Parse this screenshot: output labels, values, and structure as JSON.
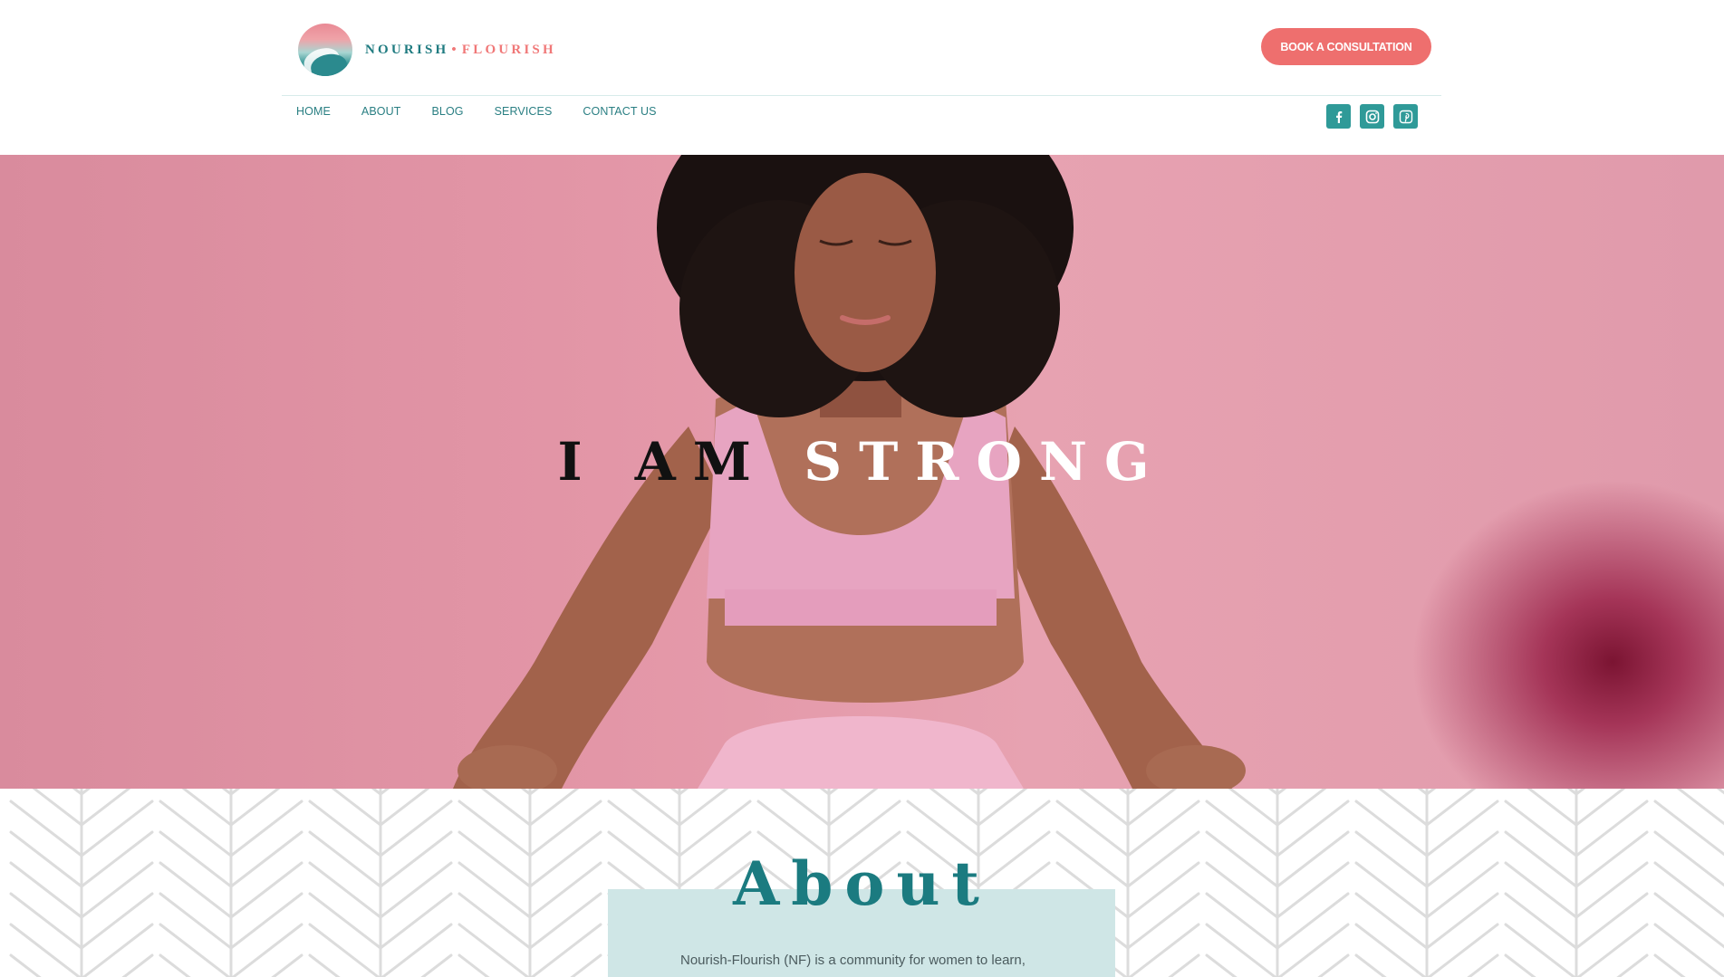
{
  "brand": {
    "name_part1": "NOURISH",
    "separator": "•",
    "name_part2": "FLOURISH",
    "colors": {
      "teal": "#1f7b80",
      "coral": "#ee6f6e",
      "social_bg": "#2f9a98"
    }
  },
  "header": {
    "cta_label": "BOOK A CONSULTATION"
  },
  "nav": {
    "items": [
      {
        "label": "HOME"
      },
      {
        "label": "ABOUT"
      },
      {
        "label": "BLOG"
      },
      {
        "label": "SERVICES"
      },
      {
        "label": "CONTACT US"
      }
    ]
  },
  "social": [
    {
      "icon": "facebook-icon"
    },
    {
      "icon": "instagram-icon"
    },
    {
      "icon": "pinterest-icon"
    }
  ],
  "hero": {
    "word1": "I AM",
    "word2": "STRONG"
  },
  "about": {
    "title": "About",
    "text": "Nourish-Flourish (NF) is a community for women to learn,"
  }
}
